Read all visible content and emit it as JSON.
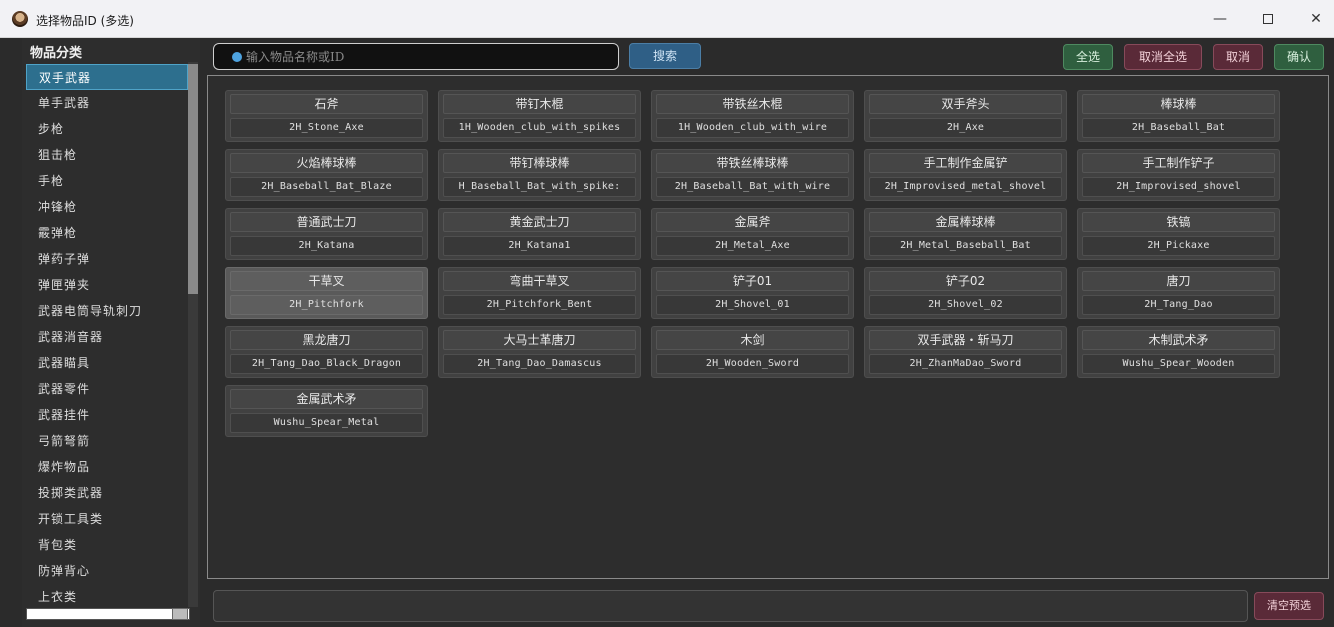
{
  "window": {
    "title": "选择物品ID (多选)",
    "minimize": "—",
    "close": "✕"
  },
  "sidebar": {
    "title": "物品分类",
    "items": [
      {
        "label": "双手武器",
        "active": true
      },
      {
        "label": "单手武器"
      },
      {
        "label": "步枪"
      },
      {
        "label": "狙击枪"
      },
      {
        "label": "手枪"
      },
      {
        "label": "冲锋枪"
      },
      {
        "label": "霰弹枪"
      },
      {
        "label": "弹药子弹"
      },
      {
        "label": "弹匣弹夹"
      },
      {
        "label": "武器电筒导轨刺刀"
      },
      {
        "label": "武器消音器"
      },
      {
        "label": "武器瞄具"
      },
      {
        "label": "武器零件"
      },
      {
        "label": "武器挂件"
      },
      {
        "label": "弓箭弩箭"
      },
      {
        "label": "爆炸物品"
      },
      {
        "label": "投掷类武器"
      },
      {
        "label": "开锁工具类"
      },
      {
        "label": "背包类"
      },
      {
        "label": "防弹背心"
      },
      {
        "label": "上衣类"
      }
    ]
  },
  "toolbar": {
    "search_placeholder": "输入物品名称或ID",
    "search_label": "搜索",
    "select_all_label": "全选",
    "unselect_all_label": "取消全选",
    "cancel_label": "取消",
    "confirm_label": "确认"
  },
  "items": [
    {
      "name": "石斧",
      "id": "2H_Stone_Axe"
    },
    {
      "name": "带钉木棍",
      "id": "1H_Wooden_club_with_spikes"
    },
    {
      "name": "带铁丝木棍",
      "id": "1H_Wooden_club_with_wire"
    },
    {
      "name": "双手斧头",
      "id": "2H_Axe"
    },
    {
      "name": "棒球棒",
      "id": "2H_Baseball_Bat"
    },
    {
      "name": "火焰棒球棒",
      "id": "2H_Baseball_Bat_Blaze"
    },
    {
      "name": "带钉棒球棒",
      "id": "H_Baseball_Bat_with_spike:"
    },
    {
      "name": "带铁丝棒球棒",
      "id": "2H_Baseball_Bat_with_wire"
    },
    {
      "name": "手工制作金属铲",
      "id": "2H_Improvised_metal_shovel"
    },
    {
      "name": "手工制作铲子",
      "id": "2H_Improvised_shovel"
    },
    {
      "name": "普通武士刀",
      "id": "2H_Katana"
    },
    {
      "name": "黄金武士刀",
      "id": "2H_Katana1"
    },
    {
      "name": "金属斧",
      "id": "2H_Metal_Axe"
    },
    {
      "name": "金属棒球棒",
      "id": "2H_Metal_Baseball_Bat"
    },
    {
      "name": "铁镐",
      "id": "2H_Pickaxe"
    },
    {
      "name": "干草叉",
      "id": "2H_Pitchfork",
      "highlight": true
    },
    {
      "name": "弯曲干草叉",
      "id": "2H_Pitchfork_Bent"
    },
    {
      "name": "铲子01",
      "id": "2H_Shovel_01"
    },
    {
      "name": "铲子02",
      "id": "2H_Shovel_02"
    },
    {
      "name": "唐刀",
      "id": "2H_Tang_Dao"
    },
    {
      "name": "黑龙唐刀",
      "id": "2H_Tang_Dao_Black_Dragon"
    },
    {
      "name": "大马士革唐刀",
      "id": "2H_Tang_Dao_Damascus"
    },
    {
      "name": "木剑",
      "id": "2H_Wooden_Sword"
    },
    {
      "name": "双手武器・斩马刀",
      "id": "2H_ZhanMaDao_Sword"
    },
    {
      "name": "木制武术矛",
      "id": "Wushu_Spear_Wooden"
    },
    {
      "name": "金属武术矛",
      "id": "Wushu_Spear_Metal"
    }
  ],
  "bottom": {
    "clear_label": "清空预选"
  },
  "colors": {
    "accent": "#2d6f8e",
    "positive": "#2f5f3f",
    "negative": "#5a2a38",
    "primary": "#2f5f86"
  }
}
